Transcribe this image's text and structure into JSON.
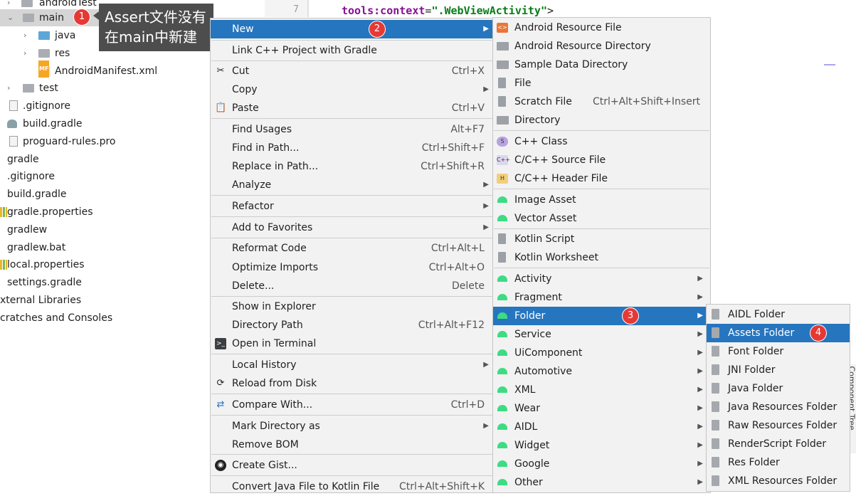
{
  "project_tree": {
    "rows": [
      {
        "label": "androidTest",
        "indent": 1
      },
      {
        "label": "main",
        "selected": true
      },
      {
        "label": "java"
      },
      {
        "label": "res"
      },
      {
        "label": "AndroidManifest.xml"
      },
      {
        "label": "test"
      },
      {
        "label": ".gitignore"
      },
      {
        "label": "build.gradle"
      },
      {
        "label": "proguard-rules.pro"
      },
      {
        "label": "gradle"
      },
      {
        "label": ".gitignore"
      },
      {
        "label": "build.gradle"
      },
      {
        "label": "gradle.properties"
      },
      {
        "label": "gradlew"
      },
      {
        "label": "gradlew.bat"
      },
      {
        "label": "local.properties"
      },
      {
        "label": "settings.gradle"
      },
      {
        "label": "xternal Libraries"
      },
      {
        "label": "cratches and Consoles"
      }
    ],
    "manifest_badge": "MF"
  },
  "annotations": {
    "tooltip_line1": "Assert文件没有",
    "tooltip_line2": "在main中新建",
    "step1": "1",
    "step2": "2",
    "step3": "3",
    "step4": "4"
  },
  "editor": {
    "line_number": "7",
    "attr": "tools:context",
    "eq": "=",
    "value": "\".WebViewActivity\"",
    "close": ">"
  },
  "side_tab": "Component Tree",
  "context_menu": {
    "new": "New",
    "link_cpp": "Link C++ Project with Gradle",
    "cut": "Cut",
    "cut_sc": "Ctrl+X",
    "copy": "Copy",
    "paste": "Paste",
    "paste_sc": "Ctrl+V",
    "find_usages": "Find Usages",
    "find_usages_sc": "Alt+F7",
    "find_in_path": "Find in Path...",
    "find_in_path_sc": "Ctrl+Shift+F",
    "replace_in_path": "Replace in Path...",
    "replace_in_path_sc": "Ctrl+Shift+R",
    "analyze": "Analyze",
    "refactor": "Refactor",
    "add_favorites": "Add to Favorites",
    "reformat": "Reformat Code",
    "reformat_sc": "Ctrl+Alt+L",
    "optimize": "Optimize Imports",
    "optimize_sc": "Ctrl+Alt+O",
    "delete": "Delete...",
    "delete_sc": "Delete",
    "show_explorer": "Show in Explorer",
    "dir_path": "Directory Path",
    "dir_path_sc": "Ctrl+Alt+F12",
    "open_terminal": "Open in Terminal",
    "local_history": "Local History",
    "reload": "Reload from Disk",
    "compare": "Compare With...",
    "compare_sc": "Ctrl+D",
    "mark_dir": "Mark Directory as",
    "remove_bom": "Remove BOM",
    "create_gist": "Create Gist...",
    "convert": "Convert Java File to Kotlin File",
    "convert_sc": "Ctrl+Alt+Shift+K"
  },
  "new_menu": {
    "android_res_file": "Android Resource File",
    "android_res_dir": "Android Resource Directory",
    "sample_data_dir": "Sample Data Directory",
    "file": "File",
    "scratch": "Scratch File",
    "scratch_sc": "Ctrl+Alt+Shift+Insert",
    "directory": "Directory",
    "cpp_class": "C++ Class",
    "cpp_source": "C/C++ Source File",
    "cpp_header": "C/C++ Header File",
    "image_asset": "Image Asset",
    "vector_asset": "Vector Asset",
    "kotlin_script": "Kotlin Script",
    "kotlin_worksheet": "Kotlin Worksheet",
    "activity": "Activity",
    "fragment": "Fragment",
    "folder": "Folder",
    "service": "Service",
    "uicomponent": "UiComponent",
    "automotive": "Automotive",
    "xml": "XML",
    "wear": "Wear",
    "aidl": "AIDL",
    "widget": "Widget",
    "google": "Google",
    "other": "Other",
    "icon_tags": {
      "xml": "<>",
      "cpp_class": "S",
      "cpp_source": "C++",
      "cpp_header": "H"
    }
  },
  "folder_menu": {
    "items": [
      "AIDL Folder",
      "Assets Folder",
      "Font Folder",
      "JNI Folder",
      "Java Folder",
      "Java Resources Folder",
      "Raw Resources Folder",
      "RenderScript Folder",
      "Res Folder",
      "XML Resources Folder"
    ],
    "highlighted": "Assets Folder"
  },
  "colors": {
    "highlight": "#2675bf",
    "badge": "#e53935",
    "android_green": "#3ddc84"
  }
}
